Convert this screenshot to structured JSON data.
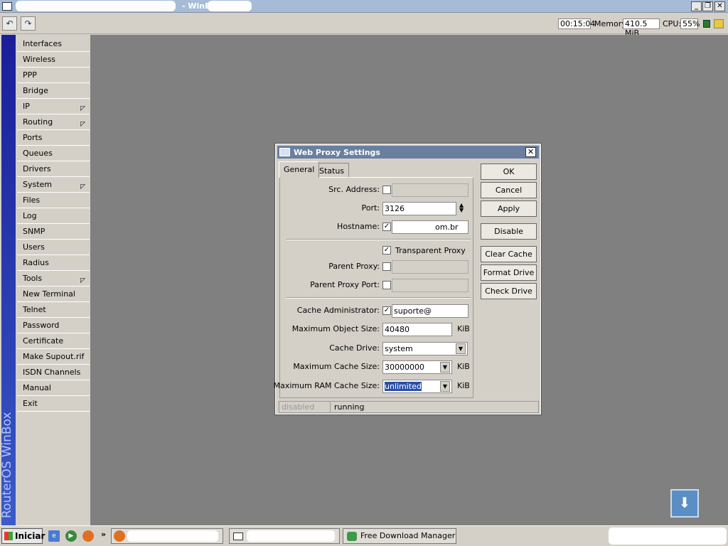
{
  "window": {
    "title": "- WinBox",
    "min": "_",
    "restore": "❐",
    "close": "✕"
  },
  "toolbar": {
    "undo": "↶",
    "redo": "↷",
    "time": "00:15:04",
    "memory_label": "Memory:",
    "memory": "410.5 MiB",
    "cpu_label": "CPU:",
    "cpu": "55%"
  },
  "sidebar": {
    "brand": "RouterOS WinBox",
    "items": [
      {
        "label": "Interfaces",
        "sub": false
      },
      {
        "label": "Wireless",
        "sub": false
      },
      {
        "label": "PPP",
        "sub": false
      },
      {
        "label": "Bridge",
        "sub": false
      },
      {
        "label": "IP",
        "sub": true
      },
      {
        "label": "Routing",
        "sub": true
      },
      {
        "label": "Ports",
        "sub": false
      },
      {
        "label": "Queues",
        "sub": false
      },
      {
        "label": "Drivers",
        "sub": false
      },
      {
        "label": "System",
        "sub": true
      },
      {
        "label": "Files",
        "sub": false
      },
      {
        "label": "Log",
        "sub": false
      },
      {
        "label": "SNMP",
        "sub": false
      },
      {
        "label": "Users",
        "sub": false
      },
      {
        "label": "Radius",
        "sub": false
      },
      {
        "label": "Tools",
        "sub": true
      },
      {
        "label": "New Terminal",
        "sub": false
      },
      {
        "label": "Telnet",
        "sub": false
      },
      {
        "label": "Password",
        "sub": false
      },
      {
        "label": "Certificate",
        "sub": false
      },
      {
        "label": "Make Supout.rif",
        "sub": false
      },
      {
        "label": "ISDN Channels",
        "sub": false
      },
      {
        "label": "Manual",
        "sub": false
      },
      {
        "label": "Exit",
        "sub": false
      }
    ]
  },
  "dialog": {
    "title": "Web Proxy Settings",
    "tabs": {
      "general": "General",
      "status": "Status"
    },
    "fields": {
      "src_address": {
        "label": "Src. Address:",
        "checked": false,
        "value": ""
      },
      "port": {
        "label": "Port:",
        "value": "3126"
      },
      "hostname": {
        "label": "Hostname:",
        "checked": true,
        "value": "om.br"
      },
      "transparent": {
        "label": "Transparent Proxy",
        "checked": true
      },
      "parent_proxy": {
        "label": "Parent Proxy:",
        "checked": false,
        "value": ""
      },
      "parent_proxy_port": {
        "label": "Parent Proxy Port:",
        "checked": false,
        "value": ""
      },
      "cache_admin": {
        "label": "Cache Administrator:",
        "checked": true,
        "value": "suporte@"
      },
      "max_object": {
        "label": "Maximum Object Size:",
        "value": "40480",
        "unit": "KiB"
      },
      "cache_drive": {
        "label": "Cache Drive:",
        "value": "system"
      },
      "max_cache": {
        "label": "Maximum Cache Size:",
        "value": "30000000",
        "unit": "KiB"
      },
      "max_ram": {
        "label": "Maximum RAM Cache Size:",
        "value": "unlimited",
        "unit": "KiB"
      }
    },
    "buttons": {
      "ok": "OK",
      "cancel": "Cancel",
      "apply": "Apply",
      "disable": "Disable",
      "clear_cache": "Clear Cache",
      "format_drive": "Format Drive",
      "check_drive": "Check Drive"
    },
    "status": {
      "left": "disabled",
      "right": "running"
    }
  },
  "taskbar": {
    "start": "Iniciar",
    "more": "»",
    "fdm": "Free Download Manager"
  }
}
